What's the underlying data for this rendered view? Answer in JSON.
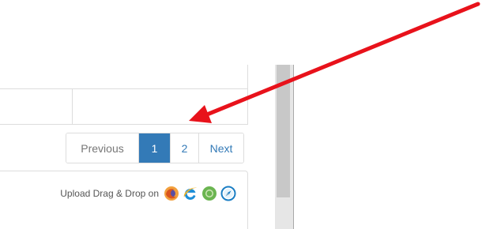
{
  "pagination": {
    "previous_label": "Previous",
    "pages": [
      "1",
      "2"
    ],
    "active_page": "1",
    "next_label": "Next"
  },
  "upload": {
    "text": "Upload Drag & Drop on",
    "browser_icons": [
      "firefox-icon",
      "internet-explorer-icon",
      "chrome-icon",
      "safari-icon"
    ]
  },
  "annotation": {
    "color": "#e8121b"
  },
  "colors": {
    "accent": "#337ab7",
    "border": "#dddddd",
    "muted_text": "#777777"
  }
}
